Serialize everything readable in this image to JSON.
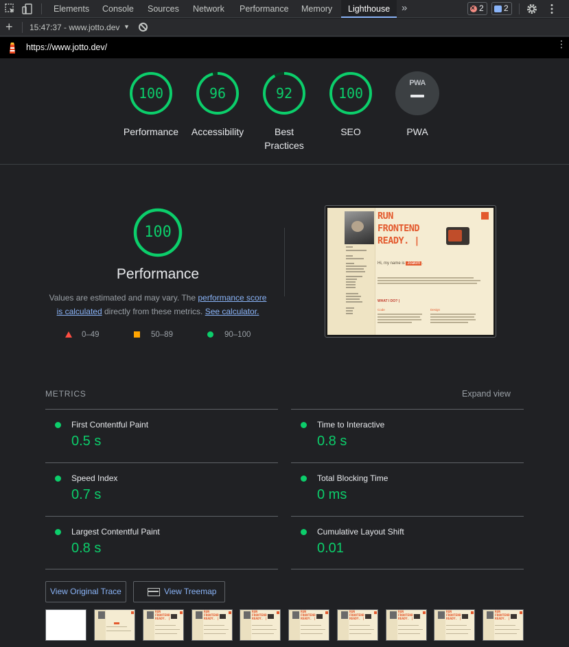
{
  "devtools": {
    "tabs": [
      "Elements",
      "Console",
      "Sources",
      "Network",
      "Performance",
      "Memory",
      "Lighthouse"
    ],
    "active_tab": "Lighthouse",
    "more_tabs": "»",
    "error_count": "2",
    "message_count": "2"
  },
  "toolbar": {
    "plus": "+",
    "report": "15:47:37 - www.jotto.dev",
    "caret": "▼"
  },
  "url": "https://www.jotto.dev/",
  "scores": [
    {
      "label": "Performance",
      "value": "100",
      "fraction": 1.0
    },
    {
      "label": "Accessibility",
      "value": "96",
      "fraction": 0.96
    },
    {
      "label": "Best Practices",
      "value": "92",
      "fraction": 0.92
    },
    {
      "label": "SEO",
      "value": "100",
      "fraction": 1.0
    }
  ],
  "pwa": {
    "label": "PWA",
    "badge_text": "PWA"
  },
  "performance": {
    "score": "100",
    "title": "Performance",
    "desc_prefix": "Values are estimated and may vary. The ",
    "link_score": "performance score is calculated",
    "desc_mid": " directly from these metrics. ",
    "link_calc": "See calculator.",
    "legend": [
      "0–49",
      "50–89",
      "90–100"
    ]
  },
  "screenshot": {
    "headline": [
      "RUN",
      "FRONTEND",
      "READY. |"
    ],
    "intro": "Hi, my name is",
    "name": "Joakim",
    "intro_end": ".",
    "what": "WHAT I DO? |",
    "col1": "Code",
    "col2": "Design"
  },
  "metrics": {
    "heading": "METRICS",
    "expand": "Expand view",
    "items": [
      {
        "name": "First Contentful Paint",
        "value": "0.5 s"
      },
      {
        "name": "Time to Interactive",
        "value": "0.8 s"
      },
      {
        "name": "Speed Index",
        "value": "0.7 s"
      },
      {
        "name": "Total Blocking Time",
        "value": "0 ms"
      },
      {
        "name": "Largest Contentful Paint",
        "value": "0.8 s"
      },
      {
        "name": "Cumulative Layout Shift",
        "value": "0.01"
      }
    ]
  },
  "buttons": {
    "trace": "View Original Trace",
    "treemap": "View Treemap"
  },
  "filmstrip": {
    "frame_headline": [
      "RUN",
      "FRONTEND",
      "READY. |"
    ]
  },
  "colors": {
    "pass": "#0cce6b",
    "average": "#ffa400",
    "fail": "#ff4e42",
    "link": "#8ab4f8"
  }
}
